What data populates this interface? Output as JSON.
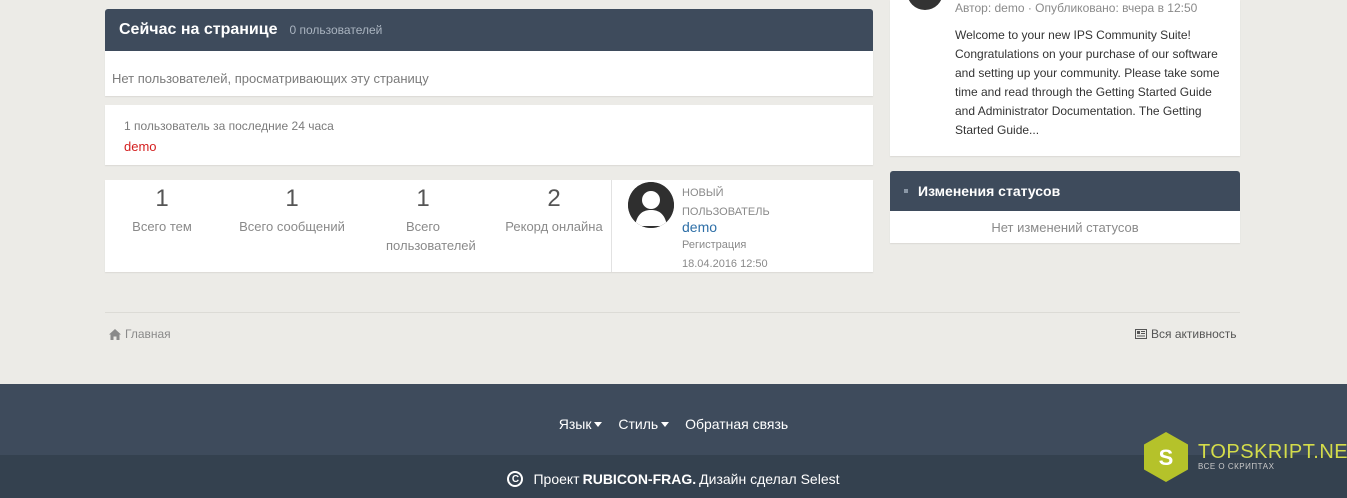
{
  "online": {
    "title": "Сейчас на странице",
    "count": "0 пользователей",
    "empty": "Нет пользователей, просматривающих эту страницу"
  },
  "last24": {
    "title": "1 пользователь за последние 24 часа",
    "users": [
      "demo"
    ]
  },
  "stats": [
    {
      "value": "1",
      "label": "Всего тем"
    },
    {
      "value": "1",
      "label": "Всего сообщений"
    },
    {
      "value": "1",
      "label": "Всего пользователей"
    },
    {
      "value": "2",
      "label": "Рекорд онлайна"
    }
  ],
  "newest": {
    "label": "Новый пользователь",
    "name": "demo",
    "reg_label": "Регистрация",
    "reg_date": "18.04.2016 12:50"
  },
  "post": {
    "meta": "Автор: demo · Опубликовано: вчера в 12:50",
    "text": "Welcome to your new IPS Community Suite! Congratulations on your purchase of our software and setting up your community. Please take some time and read through the Getting Started Guide and Administrator Documentation. The Getting Started Guide..."
  },
  "status_updates": {
    "title": "Изменения статусов",
    "empty": "Нет изменений статусов"
  },
  "breadcrumb": {
    "home": "Главная",
    "activity": "Вся активность"
  },
  "footer": {
    "language": "Язык",
    "style": "Стиль",
    "contact": "Обратная связь",
    "copy_prefix": "Проект",
    "project": "RUBICON-FRAG.",
    "copy_suffix": "Дизайн сделал Selest",
    "copy_icon": "C"
  },
  "watermark": {
    "logo_letter": "S",
    "name": "TOPSKRIPT.NET",
    "tagline": "ВСЕ О СКРИПТАХ"
  },
  "colors": {
    "header_bg": "#3e4b5c",
    "footer_bg": "#34414f",
    "link_red": "#d41f1f",
    "link_blue": "#2e6fa7",
    "page_bg": "#ecebe7"
  }
}
